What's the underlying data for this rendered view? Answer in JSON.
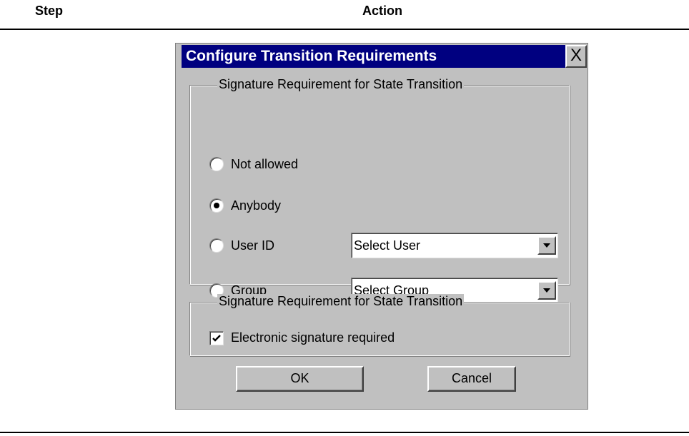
{
  "table_header": {
    "step": "Step",
    "action": "Action"
  },
  "dialog": {
    "title": "Configure Transition Requirements",
    "close_label": "X",
    "group1": {
      "legend": "Signature Requirement for State Transition",
      "options": [
        {
          "label": "Not allowed",
          "checked": false
        },
        {
          "label": "Anybody",
          "checked": true
        },
        {
          "label": "User ID",
          "checked": false
        },
        {
          "label": "Group",
          "checked": false
        }
      ],
      "user_select": "Select User",
      "group_select": "Select Group"
    },
    "group2": {
      "legend": "Signature Requirement for State Transition",
      "checkbox_label": "Electronic signature required",
      "checkbox_checked": true
    },
    "ok_label": "OK",
    "cancel_label": "Cancel"
  },
  "colors": {
    "titlebar": "#000080",
    "dialog_bg": "#c0c0c0"
  }
}
